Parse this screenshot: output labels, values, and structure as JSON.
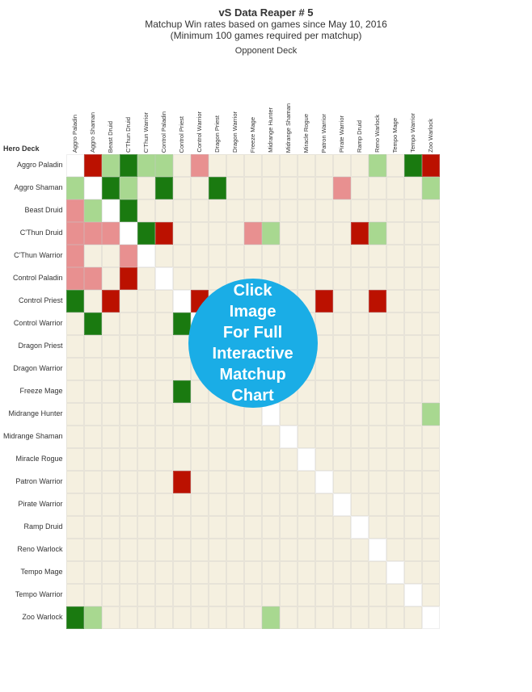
{
  "title": {
    "line1": "vS Data Reaper # 5",
    "line2": "Matchup Win rates based on games since May 10, 2016",
    "line3": "(Minimum 100 games required per matchup)"
  },
  "opponent_deck_label": "Opponent Deck",
  "hero_deck_label": "Hero Deck",
  "click_circle_text": "Click\nImage\nFor Full\nInteractive\nMatchup\nChart",
  "col_headers": [
    "Aggro Paladin",
    "Aggro Shaman",
    "Beast Druid",
    "C'Thun Druid",
    "C'Thun Warrior",
    "Control Paladin",
    "Control Priest",
    "Control Warrior",
    "Dragon Priest",
    "Dragon Warrior",
    "Freeze Mage",
    "Midrange Hunter",
    "Midrange Shaman",
    "Miracle Rogue",
    "Patron Warrior",
    "Pirate Warrior",
    "Ramp Druid",
    "Reno Warlock",
    "Tempo Mage",
    "Tempo Warrior",
    "Zoo Warlock"
  ],
  "row_headers": [
    "Aggro Paladin",
    "Aggro Shaman",
    "Beast Druid",
    "C'Thun Druid",
    "C'Thun Warrior",
    "Control Paladin",
    "Control Priest",
    "Control Warrior",
    "Dragon Priest",
    "Dragon Warrior",
    "Freeze Mage",
    "Midrange Hunter",
    "Midrange Shaman",
    "Miracle Rogue",
    "Patron Warrior",
    "Pirate Warrior",
    "Ramp Druid",
    "Reno Warlock",
    "Tempo Mage",
    "Tempo Warrior",
    "Zoo Warlock"
  ],
  "grid": [
    [
      "w",
      "r",
      "lg",
      "w",
      "",
      "lg",
      "",
      "",
      "",
      "",
      "",
      "",
      "",
      "",
      "",
      "",
      "",
      "lg",
      "",
      "",
      "r"
    ],
    [
      "lg",
      "w",
      "g",
      "lg",
      "",
      "g",
      "",
      "",
      "g",
      "",
      "",
      "",
      "",
      "",
      "",
      "",
      "",
      "",
      "",
      "",
      "lg"
    ],
    [
      "lr",
      "g",
      "w",
      "g",
      "",
      "",
      "",
      "",
      "",
      "",
      "",
      "",
      "",
      "",
      "",
      "",
      "",
      "",
      "",
      "",
      ""
    ],
    [
      "lr",
      "lr",
      "lr",
      "w",
      "g",
      "r",
      "",
      "",
      "",
      "",
      "lr",
      "lg",
      "",
      "",
      "",
      "",
      "",
      "lg",
      "",
      "",
      ""
    ],
    [
      "",
      "",
      "",
      "lr",
      "w",
      "",
      "",
      "",
      "",
      "",
      "",
      "",
      "",
      "",
      "",
      "",
      "",
      "",
      "",
      "",
      ""
    ],
    [
      "lr",
      "lr",
      "",
      "r",
      "",
      "w",
      "",
      "",
      "",
      "",
      "",
      "",
      "",
      "",
      "",
      "",
      "",
      "",
      "",
      "",
      ""
    ],
    [
      "g",
      "",
      "r",
      "",
      "",
      "",
      "w",
      "r",
      "",
      "r",
      "",
      "",
      "",
      "",
      "r",
      "",
      "",
      "",
      "",
      "",
      ""
    ],
    [
      "",
      "g",
      "",
      "",
      "",
      "",
      "g",
      "w",
      "",
      "",
      "",
      "",
      "",
      "",
      "",
      "",
      "",
      "",
      "",
      "",
      ""
    ],
    [
      "",
      "",
      "",
      "",
      "",
      "",
      "",
      "",
      "w",
      "",
      "",
      "",
      "",
      "",
      "",
      "",
      "",
      "",
      "",
      "",
      ""
    ],
    [
      "",
      "",
      "",
      "",
      "",
      "",
      "",
      "",
      "",
      "w",
      "",
      "",
      "",
      "",
      "",
      "",
      "",
      "",
      "",
      "",
      ""
    ],
    [
      "",
      "",
      "",
      "",
      "",
      "",
      "g",
      "",
      "",
      "",
      "w",
      "",
      "",
      "",
      "",
      "",
      "",
      "",
      "",
      "",
      ""
    ],
    [
      "",
      "",
      "",
      "",
      "",
      "",
      "",
      "",
      "",
      "",
      "",
      "w",
      "",
      "",
      "",
      "",
      "",
      "",
      "",
      "",
      "lg"
    ],
    [
      "",
      "",
      "",
      "",
      "",
      "",
      "",
      "",
      "",
      "",
      "",
      "",
      "w",
      "",
      "",
      "",
      "",
      "",
      "",
      "",
      ""
    ],
    [
      "",
      "",
      "",
      "",
      "",
      "",
      "",
      "",
      "",
      "",
      "",
      "",
      "",
      "w",
      "",
      "",
      "",
      "",
      "",
      "",
      ""
    ],
    [
      "",
      "",
      "",
      "",
      "",
      "",
      "r",
      "",
      "",
      "",
      "",
      "",
      "",
      "",
      "w",
      "",
      "",
      "",
      "",
      "",
      ""
    ],
    [
      "",
      "",
      "",
      "",
      "",
      "",
      "",
      "",
      "",
      "",
      "",
      "",
      "",
      "",
      "",
      "w",
      "",
      "",
      "",
      "",
      ""
    ],
    [
      "",
      "",
      "",
      "",
      "",
      "",
      "",
      "",
      "",
      "",
      "",
      "",
      "",
      "",
      "",
      "",
      "w",
      "",
      "",
      "",
      ""
    ],
    [
      "",
      "",
      "",
      "",
      "",
      "",
      "",
      "",
      "",
      "",
      "",
      "",
      "",
      "",
      "",
      "",
      "",
      "w",
      "",
      "",
      ""
    ],
    [
      "",
      "",
      "",
      "",
      "",
      "",
      "",
      "",
      "",
      "",
      "",
      "",
      "",
      "",
      "",
      "",
      "",
      "",
      "w",
      "",
      ""
    ],
    [
      "",
      "",
      "",
      "",
      "",
      "",
      "",
      "",
      "",
      "",
      "",
      "",
      "",
      "",
      "",
      "",
      "",
      "",
      "",
      "w",
      ""
    ],
    [
      "g",
      "lg",
      "",
      "",
      "",
      "",
      "",
      "",
      "",
      "",
      "",
      "lg",
      "",
      "",
      "",
      "",
      "",
      "",
      "",
      "",
      "w"
    ]
  ],
  "cell_colors": {
    "w": "#ffffff",
    "g": "#2e8b20",
    "lg": "#90ee90",
    "r": "#cc2200",
    "lr": "#f08080",
    "": "#f5f0e8"
  }
}
